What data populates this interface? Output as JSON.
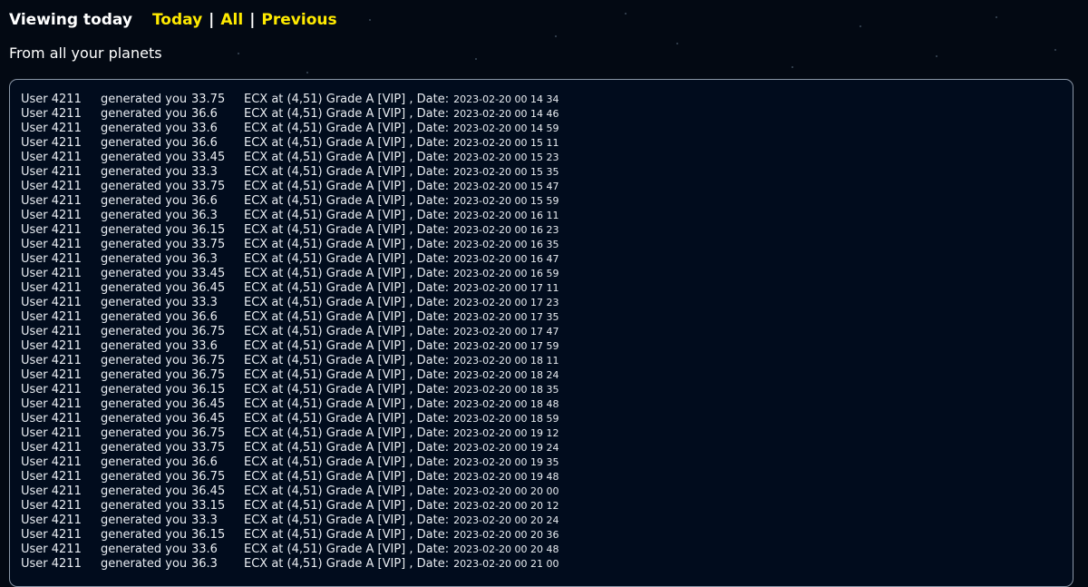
{
  "header": {
    "viewing_label": "Viewing today",
    "nav": {
      "today": "Today",
      "all": "All",
      "previous": "Previous",
      "separator": "|"
    }
  },
  "subtitle": "From all your planets",
  "log_rows": [
    {
      "user": "User 4211",
      "generated": "generated you",
      "amount": "33.75",
      "details": "ECX at (4,51) Grade A [VIP] , Date:",
      "date": "2023-02-20 00 14 34"
    },
    {
      "user": "User 4211",
      "generated": "generated you",
      "amount": "36.6",
      "details": "ECX at (4,51) Grade A [VIP] , Date:",
      "date": "2023-02-20 00 14 46"
    },
    {
      "user": "User 4211",
      "generated": "generated you",
      "amount": "33.6",
      "details": "ECX at (4,51) Grade A [VIP] , Date:",
      "date": "2023-02-20 00 14 59"
    },
    {
      "user": "User 4211",
      "generated": "generated you",
      "amount": "36.6",
      "details": "ECX at (4,51) Grade A [VIP] , Date:",
      "date": "2023-02-20 00 15 11"
    },
    {
      "user": "User 4211",
      "generated": "generated you",
      "amount": "33.45",
      "details": "ECX at (4,51) Grade A [VIP] , Date:",
      "date": "2023-02-20 00 15 23"
    },
    {
      "user": "User 4211",
      "generated": "generated you",
      "amount": "33.3",
      "details": "ECX at (4,51) Grade A [VIP] , Date:",
      "date": "2023-02-20 00 15 35"
    },
    {
      "user": "User 4211",
      "generated": "generated you",
      "amount": "33.75",
      "details": "ECX at (4,51) Grade A [VIP] , Date:",
      "date": "2023-02-20 00 15 47"
    },
    {
      "user": "User 4211",
      "generated": "generated you",
      "amount": "36.6",
      "details": "ECX at (4,51) Grade A [VIP] , Date:",
      "date": "2023-02-20 00 15 59"
    },
    {
      "user": "User 4211",
      "generated": "generated you",
      "amount": "36.3",
      "details": "ECX at (4,51) Grade A [VIP] , Date:",
      "date": "2023-02-20 00 16 11"
    },
    {
      "user": "User 4211",
      "generated": "generated you",
      "amount": "36.15",
      "details": "ECX at (4,51) Grade A [VIP] , Date:",
      "date": "2023-02-20 00 16 23"
    },
    {
      "user": "User 4211",
      "generated": "generated you",
      "amount": "33.75",
      "details": "ECX at (4,51) Grade A [VIP] , Date:",
      "date": "2023-02-20 00 16 35"
    },
    {
      "user": "User 4211",
      "generated": "generated you",
      "amount": "36.3",
      "details": "ECX at (4,51) Grade A [VIP] , Date:",
      "date": "2023-02-20 00 16 47"
    },
    {
      "user": "User 4211",
      "generated": "generated you",
      "amount": "33.45",
      "details": "ECX at (4,51) Grade A [VIP] , Date:",
      "date": "2023-02-20 00 16 59"
    },
    {
      "user": "User 4211",
      "generated": "generated you",
      "amount": "36.45",
      "details": "ECX at (4,51) Grade A [VIP] , Date:",
      "date": "2023-02-20 00 17 11"
    },
    {
      "user": "User 4211",
      "generated": "generated you",
      "amount": "33.3",
      "details": "ECX at (4,51) Grade A [VIP] , Date:",
      "date": "2023-02-20 00 17 23"
    },
    {
      "user": "User 4211",
      "generated": "generated you",
      "amount": "36.6",
      "details": "ECX at (4,51) Grade A [VIP] , Date:",
      "date": "2023-02-20 00 17 35"
    },
    {
      "user": "User 4211",
      "generated": "generated you",
      "amount": "36.75",
      "details": "ECX at (4,51) Grade A [VIP] , Date:",
      "date": "2023-02-20 00 17 47"
    },
    {
      "user": "User 4211",
      "generated": "generated you",
      "amount": "33.6",
      "details": "ECX at (4,51) Grade A [VIP] , Date:",
      "date": "2023-02-20 00 17 59"
    },
    {
      "user": "User 4211",
      "generated": "generated you",
      "amount": "36.75",
      "details": "ECX at (4,51) Grade A [VIP] , Date:",
      "date": "2023-02-20 00 18 11"
    },
    {
      "user": "User 4211",
      "generated": "generated you",
      "amount": "36.75",
      "details": "ECX at (4,51) Grade A [VIP] , Date:",
      "date": "2023-02-20 00 18 24"
    },
    {
      "user": "User 4211",
      "generated": "generated you",
      "amount": "36.15",
      "details": "ECX at (4,51) Grade A [VIP] , Date:",
      "date": "2023-02-20 00 18 35"
    },
    {
      "user": "User 4211",
      "generated": "generated you",
      "amount": "36.45",
      "details": "ECX at (4,51) Grade A [VIP] , Date:",
      "date": "2023-02-20 00 18 48"
    },
    {
      "user": "User 4211",
      "generated": "generated you",
      "amount": "36.45",
      "details": "ECX at (4,51) Grade A [VIP] , Date:",
      "date": "2023-02-20 00 18 59"
    },
    {
      "user": "User 4211",
      "generated": "generated you",
      "amount": "36.75",
      "details": "ECX at (4,51) Grade A [VIP] , Date:",
      "date": "2023-02-20 00 19 12"
    },
    {
      "user": "User 4211",
      "generated": "generated you",
      "amount": "33.75",
      "details": "ECX at (4,51) Grade A [VIP] , Date:",
      "date": "2023-02-20 00 19 24"
    },
    {
      "user": "User 4211",
      "generated": "generated you",
      "amount": "36.6",
      "details": "ECX at (4,51) Grade A [VIP] , Date:",
      "date": "2023-02-20 00 19 35"
    },
    {
      "user": "User 4211",
      "generated": "generated you",
      "amount": "36.75",
      "details": "ECX at (4,51) Grade A [VIP] , Date:",
      "date": "2023-02-20 00 19 48"
    },
    {
      "user": "User 4211",
      "generated": "generated you",
      "amount": "36.45",
      "details": "ECX at (4,51) Grade A [VIP] , Date:",
      "date": "2023-02-20 00 20 00"
    },
    {
      "user": "User 4211",
      "generated": "generated you",
      "amount": "33.15",
      "details": "ECX at (4,51) Grade A [VIP] , Date:",
      "date": "2023-02-20 00 20 12"
    },
    {
      "user": "User 4211",
      "generated": "generated you",
      "amount": "33.3",
      "details": "ECX at (4,51) Grade A [VIP] , Date:",
      "date": "2023-02-20 00 20 24"
    },
    {
      "user": "User 4211",
      "generated": "generated you",
      "amount": "36.15",
      "details": "ECX at (4,51) Grade A [VIP] , Date:",
      "date": "2023-02-20 00 20 36"
    },
    {
      "user": "User 4211",
      "generated": "generated you",
      "amount": "33.6",
      "details": "ECX at (4,51) Grade A [VIP] , Date:",
      "date": "2023-02-20 00 20 48"
    },
    {
      "user": "User 4211",
      "generated": "generated you",
      "amount": "36.3",
      "details": "ECX at (4,51) Grade A [VIP] , Date:",
      "date": "2023-02-20 00 21 00"
    }
  ]
}
